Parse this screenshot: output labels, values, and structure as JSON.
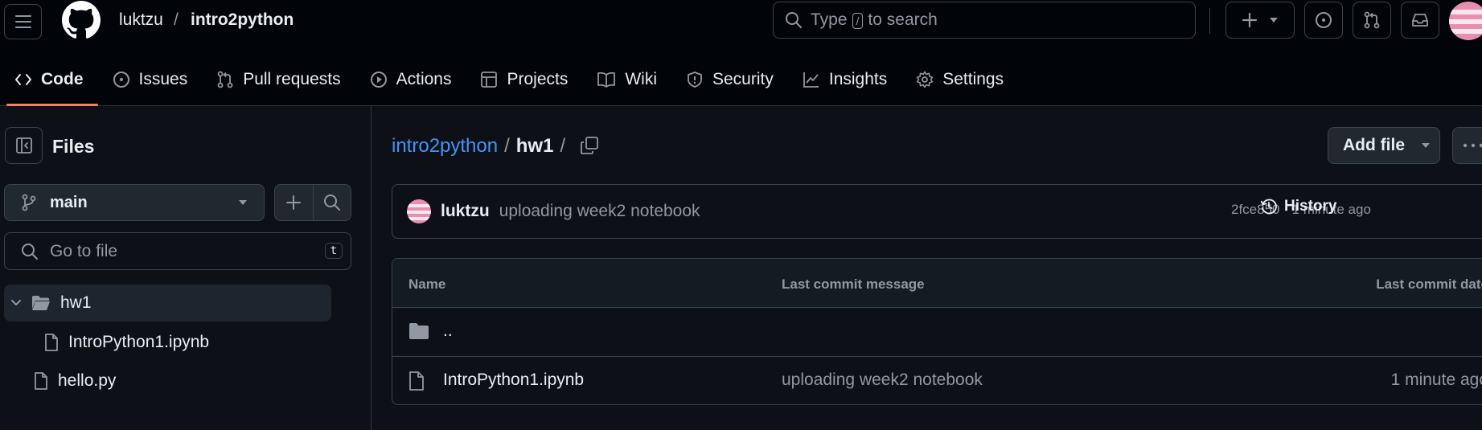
{
  "header": {
    "owner": "luktzu",
    "separator": "/",
    "repo": "intro2python",
    "search_prefix": "Type",
    "search_key": "/",
    "search_suffix": "to search",
    "icons": [
      "menu-icon",
      "github-logo-icon",
      "search-icon",
      "plus-icon",
      "triangle-down-icon",
      "issue-opened-icon",
      "git-pull-request-icon",
      "inbox-icon",
      "avatar"
    ]
  },
  "tabs": [
    {
      "label": "Code",
      "icon": "code-icon",
      "active": true
    },
    {
      "label": "Issues",
      "icon": "issue-opened-icon"
    },
    {
      "label": "Pull requests",
      "icon": "git-pull-request-icon"
    },
    {
      "label": "Actions",
      "icon": "play-icon"
    },
    {
      "label": "Projects",
      "icon": "table-icon"
    },
    {
      "label": "Wiki",
      "icon": "book-icon"
    },
    {
      "label": "Security",
      "icon": "shield-icon"
    },
    {
      "label": "Insights",
      "icon": "graph-icon"
    },
    {
      "label": "Settings",
      "icon": "gear-icon"
    }
  ],
  "sidebar": {
    "title": "Files",
    "branch": "main",
    "goto_placeholder": "Go to file",
    "goto_key": "t",
    "tree": {
      "folder": "hw1",
      "child": "IntroPython1.ipynb",
      "root_file": "hello.py"
    }
  },
  "main": {
    "breadcrumb": {
      "repo": "intro2python",
      "sep1": "/",
      "dir": "hw1",
      "sep2": "/"
    },
    "add_file": "Add file",
    "commit": {
      "author": "luktzu",
      "message": "uploading week2 notebook",
      "meta": "2fce850 · 1 minute ago",
      "history": "History"
    },
    "table": {
      "headers": [
        "Name",
        "Last commit message",
        "Last commit date"
      ],
      "rows": [
        {
          "name": "..",
          "icon": "folder-icon",
          "message": "",
          "date": ""
        },
        {
          "name": "IntroPython1.ipynb",
          "icon": "file-icon",
          "message": "uploading week2 notebook",
          "date": "1 minute ago"
        }
      ]
    }
  },
  "colors": {
    "background": "#0d1117",
    "header_bg": "#010409",
    "link": "#4493f8",
    "active_tab_underline": "#f78166",
    "muted_text": "#9198a1",
    "border": "#3d444d",
    "avatar_pink": "#e88fb0"
  }
}
